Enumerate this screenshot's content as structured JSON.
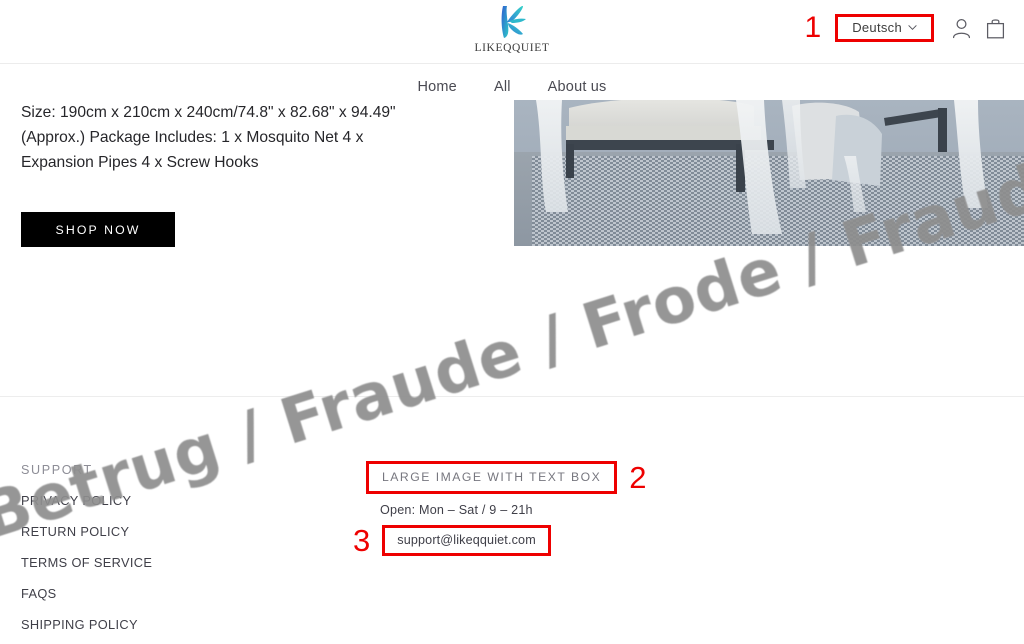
{
  "header": {
    "logo_text": "LIKEQQUIET",
    "logo_icon": "k-logo-icon",
    "language_selector": {
      "value": "Deutsch",
      "chevron_icon": "chevron-down-icon"
    },
    "account_icon": "account-person-icon",
    "bag_icon": "shopping-bag-icon"
  },
  "nav": {
    "items": [
      {
        "label": "Home"
      },
      {
        "label": "All"
      },
      {
        "label": "About us"
      }
    ]
  },
  "main": {
    "product_description": "Size: 190cm x 210cm x 240cm/74.8\" x 82.68\" x 94.49\" (Approx.) Package Includes: 1 x Mosquito Net 4 x Expansion Pipes 4 x Screw Hooks",
    "shop_now_label": "SHOP NOW",
    "product_image_alt": "bed-with-mosquito-net-canopy-on-woven-rug"
  },
  "footer": {
    "support_heading": "SUPPORT",
    "links": [
      {
        "label": "PRIVACY POLICY"
      },
      {
        "label": "RETURN POLICY"
      },
      {
        "label": "TERMS OF SERVICE"
      },
      {
        "label": "FAQS"
      },
      {
        "label": "SHIPPING POLICY"
      }
    ],
    "text_box_title": "LARGE IMAGE WITH TEXT BOX",
    "open_hours": "Open: Mon – Sat / 9 – 21h",
    "email": "support@likeqquiet.com"
  },
  "annotations": {
    "one": "1",
    "two": "2",
    "three": "3",
    "box_color": "#ee0000"
  },
  "watermark": {
    "text": "Betrug / Fraude / Frode / Fraud",
    "color": "#8e8e8e"
  }
}
